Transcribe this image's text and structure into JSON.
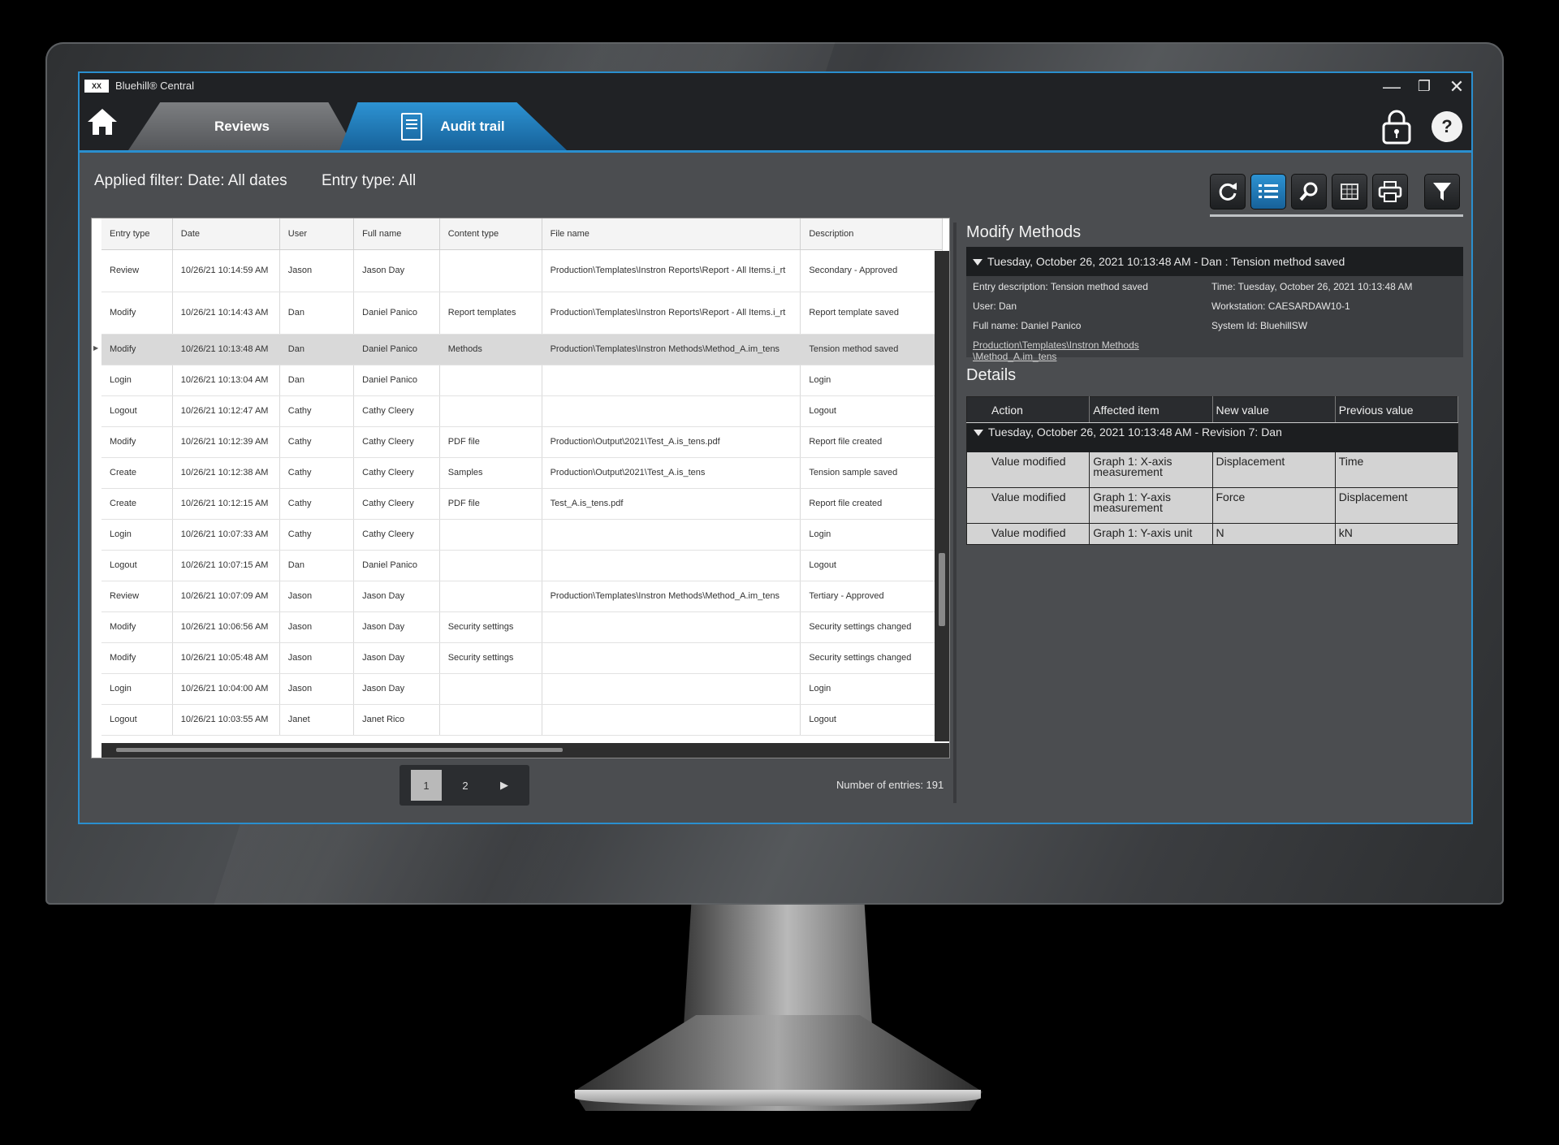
{
  "app": {
    "logo_text": "XX",
    "title": "Bluehill® Central",
    "minimize": "—",
    "maximize": "❐",
    "close": "✕",
    "help": "?"
  },
  "tabs": [
    {
      "label": "Reviews"
    },
    {
      "label": "Audit trail"
    }
  ],
  "filter": {
    "date": "Applied filter: Date: All dates",
    "entry_type": "Entry type: All"
  },
  "toolbar": {
    "icons": [
      "refresh-icon",
      "list-view-icon",
      "search-icon",
      "export-icon",
      "print-icon",
      "filter-icon"
    ],
    "active": "list-view-icon"
  },
  "grid": {
    "columns": [
      "Entry type",
      "Date",
      "User",
      "Full name",
      "Content type",
      "File name",
      "Description"
    ],
    "rows": [
      [
        "Review",
        "10/26/21 10:14:59 AM",
        "Jason",
        "Jason Day",
        "",
        "Production\\Templates\\Instron Reports\\Report - All Items.i_rt",
        "Secondary - Approved"
      ],
      [
        "Modify",
        "10/26/21 10:14:43 AM",
        "Dan",
        "Daniel Panico",
        "Report templates",
        "Production\\Templates\\Instron Reports\\Report - All Items.i_rt",
        "Report template saved"
      ],
      [
        "Modify",
        "10/26/21 10:13:48 AM",
        "Dan",
        "Daniel Panico",
        "Methods",
        "Production\\Templates\\Instron Methods\\Method_A.im_tens",
        "Tension method saved"
      ],
      [
        "Login",
        "10/26/21 10:13:04 AM",
        "Dan",
        "Daniel Panico",
        "",
        "",
        "Login"
      ],
      [
        "Logout",
        "10/26/21 10:12:47 AM",
        "Cathy",
        "Cathy Cleery",
        "",
        "",
        "Logout"
      ],
      [
        "Modify",
        "10/26/21 10:12:39 AM",
        "Cathy",
        "Cathy Cleery",
        "PDF file",
        "Production\\Output\\2021\\Test_A.is_tens.pdf",
        "Report file created"
      ],
      [
        "Create",
        "10/26/21 10:12:38 AM",
        "Cathy",
        "Cathy Cleery",
        "Samples",
        "Production\\Output\\2021\\Test_A.is_tens",
        "Tension sample saved"
      ],
      [
        "Create",
        "10/26/21 10:12:15 AM",
        "Cathy",
        "Cathy Cleery",
        "PDF file",
        "Test_A.is_tens.pdf",
        "Report file created"
      ],
      [
        "Login",
        "10/26/21 10:07:33 AM",
        "Cathy",
        "Cathy Cleery",
        "",
        "",
        "Login"
      ],
      [
        "Logout",
        "10/26/21 10:07:15 AM",
        "Dan",
        "Daniel Panico",
        "",
        "",
        "Logout"
      ],
      [
        "Review",
        "10/26/21 10:07:09 AM",
        "Jason",
        "Jason Day",
        "",
        "Production\\Templates\\Instron Methods\\Method_A.im_tens",
        "Tertiary - Approved"
      ],
      [
        "Modify",
        "10/26/21 10:06:56 AM",
        "Jason",
        "Jason Day",
        "Security settings",
        "",
        "Security settings changed"
      ],
      [
        "Modify",
        "10/26/21 10:05:48 AM",
        "Jason",
        "Jason Day",
        "Security settings",
        "",
        "Security settings changed"
      ],
      [
        "Login",
        "10/26/21 10:04:00 AM",
        "Jason",
        "Jason Day",
        "",
        "",
        "Login"
      ],
      [
        "Logout",
        "10/26/21 10:03:55 AM",
        "Janet",
        "Janet Rico",
        "",
        "",
        "Logout"
      ]
    ],
    "selected_row": 2
  },
  "pager": {
    "pages": [
      "1",
      "2"
    ],
    "current": "1",
    "next": "▶"
  },
  "entries": "Number of entries: 191",
  "detail": {
    "heading": "Modify Methods",
    "event_header": "Tuesday, October 26, 2021 10:13:48 AM - Dan : Tension method saved",
    "entry_description": "Entry description: Tension method saved",
    "user": "User: Dan",
    "full_name": "Full name: Daniel Panico",
    "file_link_1": "Production\\Templates\\Instron Methods",
    "file_link_2": "\\Method_A.im_tens",
    "time": "Time: Tuesday, October 26, 2021 10:13:48 AM",
    "workstation": "Workstation: CAESARDAW10-1",
    "system_id": "System Id: BluehillSW",
    "details_heading": "Details",
    "columns": [
      "Action",
      "Affected item",
      "New value",
      "Previous value"
    ],
    "revision": "Tuesday, October 26, 2021 10:13:48 AM - Revision 7: Dan",
    "rows": [
      [
        "Value modified",
        "Graph 1: X-axis measurement",
        "Displacement",
        "Time"
      ],
      [
        "Value modified",
        "Graph 1: Y-axis measurement",
        "Force",
        "Displacement"
      ],
      [
        "Value modified",
        "Graph 1: Y-axis unit",
        "N",
        "kN"
      ]
    ]
  }
}
